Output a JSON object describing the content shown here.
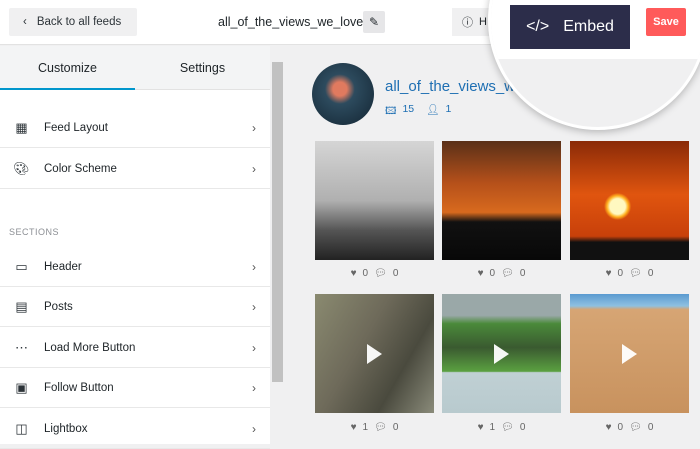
{
  "header": {
    "back_label": "Back to all feeds",
    "feed_title": "all_of_the_views_we_love",
    "help_label": "H",
    "embed_label": "Embed",
    "save_label": "Save"
  },
  "sidebar": {
    "tabs": [
      {
        "label": "Customize",
        "active": true
      },
      {
        "label": "Settings",
        "active": false
      }
    ],
    "items": [
      {
        "label": "Feed Layout",
        "icon": "grid-icon"
      },
      {
        "label": "Color Scheme",
        "icon": "palette-icon"
      }
    ],
    "sections_heading": "SECTIONS",
    "sections": [
      {
        "label": "Header",
        "icon": "header-icon"
      },
      {
        "label": "Posts",
        "icon": "posts-icon"
      },
      {
        "label": "Load More Button",
        "icon": "load-more-icon"
      },
      {
        "label": "Follow Button",
        "icon": "follow-icon"
      },
      {
        "label": "Lightbox",
        "icon": "lightbox-icon"
      }
    ]
  },
  "preview": {
    "username": "all_of_the_views_we",
    "posts_count": "15",
    "followers_count": "1",
    "posts": [
      {
        "likes": "0",
        "comments": "0",
        "video": false
      },
      {
        "likes": "0",
        "comments": "0",
        "video": false
      },
      {
        "likes": "0",
        "comments": "0",
        "video": false
      },
      {
        "likes": "1",
        "comments": "0",
        "video": true
      },
      {
        "likes": "1",
        "comments": "0",
        "video": true
      },
      {
        "likes": "0",
        "comments": "0",
        "video": true
      }
    ]
  },
  "colors": {
    "embed": "#2c2d4a",
    "save": "#ff5a5a",
    "accent": "#0096cc",
    "link": "#1e6fb3"
  }
}
